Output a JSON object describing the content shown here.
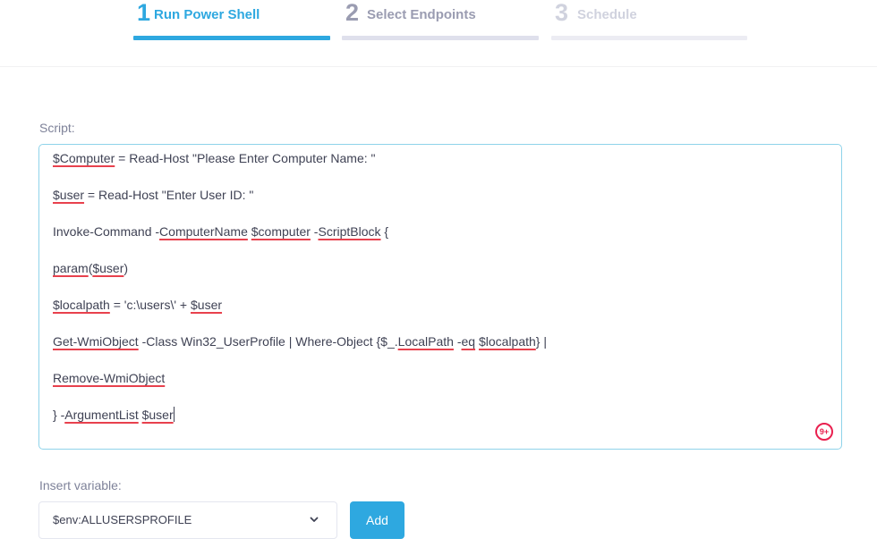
{
  "wizard": {
    "steps": [
      {
        "number": "1",
        "label": "Run Power Shell",
        "state": "active"
      },
      {
        "number": "2",
        "label": "Select Endpoints",
        "state": "pending"
      },
      {
        "number": "3",
        "label": "Schedule",
        "state": "disabled"
      }
    ],
    "colors": {
      "active": "#2ea8e0",
      "pending_text": "#9a9cb1",
      "pending_bar": "#dfe0ec",
      "disabled_text": "#d0d2de",
      "disabled_bar": "#ececf3"
    }
  },
  "script": {
    "label": "Script:",
    "lines": [
      [
        {
          "t": "$Computer",
          "err": true
        },
        {
          "t": " = Read-Host \"Please Enter Computer Name: \""
        }
      ],
      [
        {
          "t": "$user",
          "err": true
        },
        {
          "t": " = Read-Host \"Enter User ID: \""
        }
      ],
      [
        {
          "t": "Invoke-Command -"
        },
        {
          "t": "ComputerName",
          "err": true
        },
        {
          "t": " "
        },
        {
          "t": "$computer",
          "err": true
        },
        {
          "t": " -"
        },
        {
          "t": "ScriptBlock",
          "err": true
        },
        {
          "t": " {"
        }
      ],
      [
        {
          "t": "param",
          "err": true
        },
        {
          "t": "("
        },
        {
          "t": "$user",
          "err": true
        },
        {
          "t": ")"
        }
      ],
      [
        {
          "t": "$localpath",
          "err": true
        },
        {
          "t": " = 'c:\\users\\' + "
        },
        {
          "t": "$user",
          "err": true
        }
      ],
      [
        {
          "t": "Get-WmiObject",
          "err": true
        },
        {
          "t": " -Class Win32_UserProfile | Where-Object {$_."
        },
        {
          "t": "LocalPath",
          "err": true
        },
        {
          "t": " -"
        },
        {
          "t": "eq",
          "err": true
        },
        {
          "t": " "
        },
        {
          "t": "$localpath",
          "err": true
        },
        {
          "t": "} |"
        }
      ],
      [
        {
          "t": "Remove-WmiObject",
          "err": true
        }
      ],
      [
        {
          "t": "} -"
        },
        {
          "t": "ArgumentList",
          "err": true
        },
        {
          "t": " "
        },
        {
          "t": "$user",
          "err": true
        }
      ]
    ],
    "spellcheck_badge": "9+",
    "icon": "grammarly-badge-icon"
  },
  "insert_variable": {
    "label": "Insert variable:",
    "selected": "$env:ALLUSERSPROFILE",
    "chevron_icon": "chevron-down-icon",
    "add_label": "Add"
  }
}
